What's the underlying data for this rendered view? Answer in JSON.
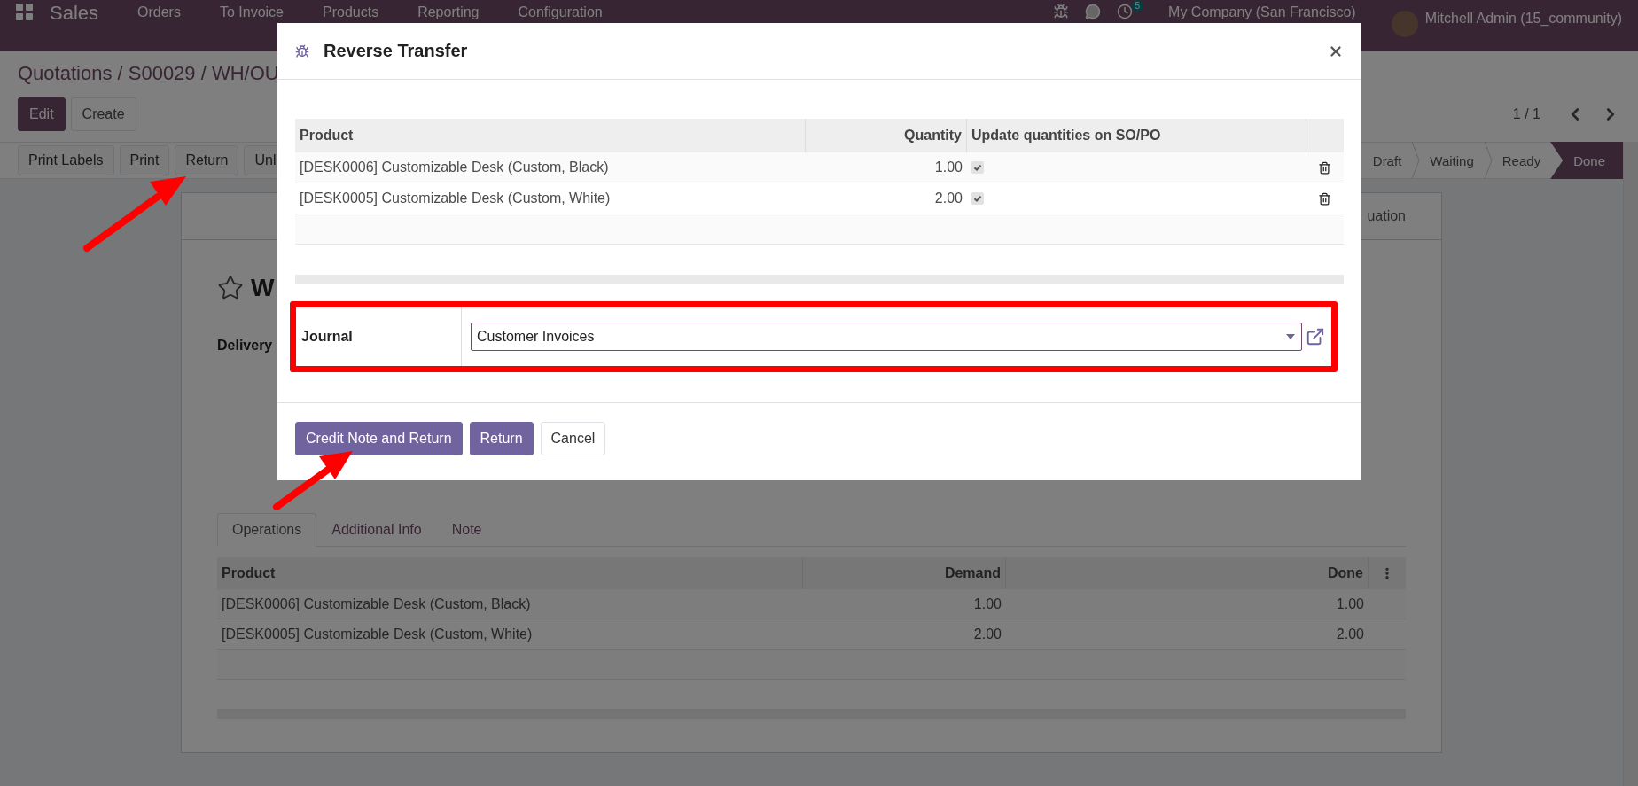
{
  "navbar": {
    "app": "Sales",
    "menu": [
      "Orders",
      "To Invoice",
      "Products",
      "Reporting",
      "Configuration"
    ],
    "activity_badge": "5",
    "company": "My Company (San Francisco)",
    "user": "Mitchell Admin (15_community)"
  },
  "breadcrumb": "Quotations / S00029 / WH/OU",
  "control_buttons": [
    {
      "label": "Edit",
      "kind": "primary"
    },
    {
      "label": "Create",
      "kind": "secondary"
    }
  ],
  "pager": "1 / 1",
  "action_buttons": [
    "Print Labels",
    "Print",
    "Return",
    "Unl"
  ],
  "statusbar": [
    {
      "label": "Draft",
      "selected": false
    },
    {
      "label": "Waiting",
      "selected": false
    },
    {
      "label": "Ready",
      "selected": false
    },
    {
      "label": "Done",
      "selected": true
    }
  ],
  "sheet": {
    "smart_button": "uation",
    "title": "W",
    "field_label": "Delivery",
    "tabs": [
      {
        "label": "Operations",
        "selected": true
      },
      {
        "label": "Additional Info",
        "selected": false
      },
      {
        "label": "Note",
        "selected": false
      }
    ],
    "table": {
      "columns": [
        "Product",
        "Demand",
        "Done"
      ],
      "rows": [
        {
          "product": "[DESK0006] Customizable Desk (Custom, Black)",
          "demand": "1.00",
          "done": "1.00"
        },
        {
          "product": "[DESK0005] Customizable Desk (Custom, White)",
          "demand": "2.00",
          "done": "2.00"
        }
      ]
    }
  },
  "dialog": {
    "title": "Reverse Transfer",
    "table": {
      "columns": [
        "Product",
        "Quantity",
        "Update quantities on SO/PO"
      ],
      "rows": [
        {
          "product": "[DESK0006] Customizable Desk (Custom, Black)",
          "quantity": "1.00",
          "update": true
        },
        {
          "product": "[DESK0005] Customizable Desk (Custom, White)",
          "quantity": "2.00",
          "update": true
        }
      ]
    },
    "journal": {
      "label": "Journal",
      "value": "Customer Invoices"
    },
    "buttons": [
      {
        "label": "Credit Note and Return",
        "kind": "primary"
      },
      {
        "label": "Return",
        "kind": "primary"
      },
      {
        "label": "Cancel",
        "kind": "secondary"
      }
    ]
  }
}
